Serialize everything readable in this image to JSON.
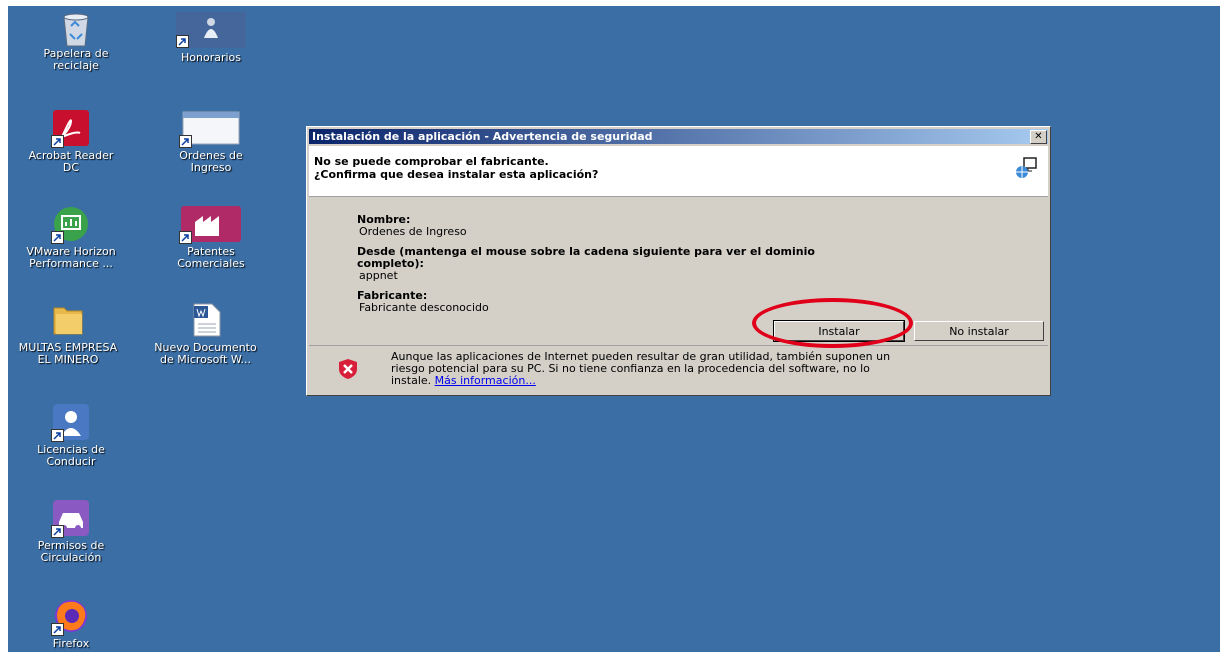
{
  "desktop": {
    "icons": [
      {
        "label1": "Papelera de",
        "label2": "reciclaje",
        "icon": "recycle-bin-icon"
      },
      {
        "label1": "Honorarios",
        "label2": "",
        "icon": "honorarios-icon"
      },
      {
        "label1": "Acrobat Reader",
        "label2": "DC",
        "icon": "acrobat-icon"
      },
      {
        "label1": "Ordenes de",
        "label2": "Ingreso",
        "icon": "window-app-icon"
      },
      {
        "label1": "VMware Horizon",
        "label2": "Performance ...",
        "icon": "vmware-icon"
      },
      {
        "label1": "Patentes",
        "label2": "Comerciales",
        "icon": "factory-icon"
      },
      {
        "label1": "MULTAS EMPRESA",
        "label2": "EL MINERO",
        "icon": "folder-icon"
      },
      {
        "label1": "Nuevo Documento",
        "label2": "de Microsoft W...",
        "icon": "word-doc-icon"
      },
      {
        "label1": "Licencias de",
        "label2": "Conducir",
        "icon": "license-icon"
      },
      {
        "label1": "Permisos de",
        "label2": "Circulación",
        "icon": "car-icon"
      },
      {
        "label1": "Firefox",
        "label2": "",
        "icon": "firefox-icon"
      }
    ]
  },
  "dialog": {
    "title": "Instalación de la aplicación - Advertencia de seguridad",
    "close": "✕",
    "header_line1": "No se puede comprobar el fabricante.",
    "header_line2": "¿Confirma que desea instalar esta aplicación?",
    "name_label": "Nombre:",
    "name_value": "Ordenes de Ingreso",
    "from_label_1": "Desde (mantenga el mouse sobre la cadena siguiente para ver el dominio",
    "from_label_2": "completo):",
    "from_value": "appnet",
    "publisher_label": "Fabricante:",
    "publisher_value": "Fabricante desconocido",
    "install_button": "Instalar",
    "dont_install_button": "No instalar",
    "warning_line1": "Aunque las aplicaciones de Internet pueden resultar de gran utilidad, también suponen un",
    "warning_line2": "riesgo potencial para su PC. Si no tiene confianza en la procedencia del software, no lo",
    "warning_line3": "instale.",
    "more_info_link": "Más información..."
  },
  "colors": {
    "desktop": "#3a6ea5",
    "highlight_ring": "#e0001a"
  }
}
